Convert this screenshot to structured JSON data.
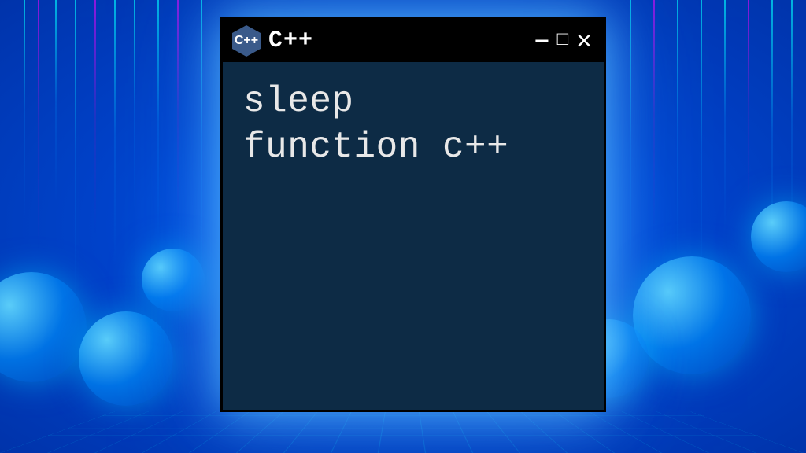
{
  "window": {
    "icon_text": "C++",
    "title": "C++",
    "controls": {
      "minimize": "−",
      "maximize": "□",
      "close": "×"
    }
  },
  "content": {
    "line1": "sleep",
    "line2": "function c++"
  }
}
